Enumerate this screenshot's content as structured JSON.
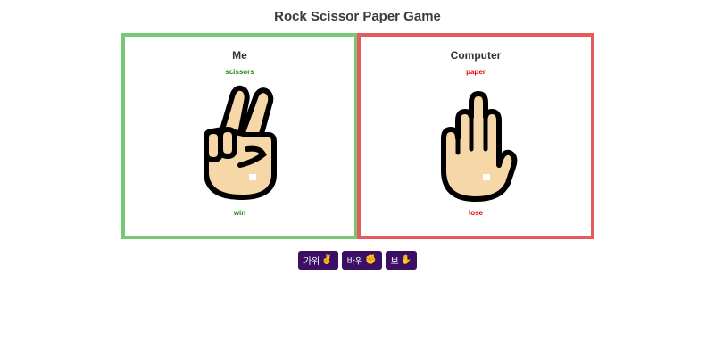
{
  "title": "Rock Scissor Paper Game",
  "colors": {
    "win": "#77c872",
    "lose": "#e55a5a",
    "win_text": "#1a8a1a",
    "lose_text": "#e60000",
    "button_bg": "#3b0f63"
  },
  "players": [
    {
      "name": "Me",
      "choice": "scissors",
      "result": "win",
      "hand_icon": "scissors-hand-icon"
    },
    {
      "name": "Computer",
      "choice": "paper",
      "result": "lose",
      "hand_icon": "paper-hand-icon"
    }
  ],
  "buttons": [
    {
      "label": "가위",
      "emoji": "✌️",
      "icon": "scissors-emoji-icon"
    },
    {
      "label": "바위",
      "emoji": "✊",
      "icon": "rock-emoji-icon"
    },
    {
      "label": "보",
      "emoji": "✋",
      "icon": "paper-emoji-icon"
    }
  ]
}
